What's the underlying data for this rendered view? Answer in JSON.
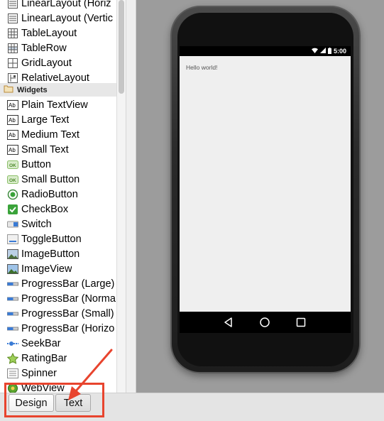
{
  "palette": {
    "layouts": [
      {
        "label": "LinearLayout (Horiz",
        "icon": "linear-layout-horizontal-icon"
      },
      {
        "label": "LinearLayout (Vertic",
        "icon": "linear-layout-vertical-icon"
      },
      {
        "label": "TableLayout",
        "icon": "table-layout-icon"
      },
      {
        "label": "TableRow",
        "icon": "table-row-icon"
      },
      {
        "label": "GridLayout",
        "icon": "grid-layout-icon"
      },
      {
        "label": "RelativeLayout",
        "icon": "relative-layout-icon"
      }
    ],
    "group_label": "Widgets",
    "widgets": [
      {
        "label": "Plain TextView",
        "icon": "textview-icon"
      },
      {
        "label": "Large Text",
        "icon": "textview-icon"
      },
      {
        "label": "Medium Text",
        "icon": "textview-icon"
      },
      {
        "label": "Small Text",
        "icon": "textview-icon"
      },
      {
        "label": "Button",
        "icon": "button-icon"
      },
      {
        "label": "Small Button",
        "icon": "button-icon"
      },
      {
        "label": "RadioButton",
        "icon": "radio-button-icon"
      },
      {
        "label": "CheckBox",
        "icon": "checkbox-icon"
      },
      {
        "label": "Switch",
        "icon": "switch-icon"
      },
      {
        "label": "ToggleButton",
        "icon": "toggle-button-icon"
      },
      {
        "label": "ImageButton",
        "icon": "image-button-icon"
      },
      {
        "label": "ImageView",
        "icon": "image-view-icon"
      },
      {
        "label": "ProgressBar (Large)",
        "icon": "progress-bar-icon"
      },
      {
        "label": "ProgressBar (Norma",
        "icon": "progress-bar-icon"
      },
      {
        "label": "ProgressBar (Small)",
        "icon": "progress-bar-icon"
      },
      {
        "label": "ProgressBar (Horizo",
        "icon": "progress-bar-icon"
      },
      {
        "label": "SeekBar",
        "icon": "seek-bar-icon"
      },
      {
        "label": "RatingBar",
        "icon": "rating-bar-icon"
      },
      {
        "label": "Spinner",
        "icon": "spinner-icon"
      },
      {
        "label": "WebView",
        "icon": "web-view-icon"
      }
    ]
  },
  "device": {
    "time": "5:00",
    "hello_text": "Hello world!"
  },
  "tabs": {
    "design": "Design",
    "text": "Text"
  },
  "colors": {
    "annotation": "#e8442e",
    "canvas": "#9c9c9c"
  }
}
